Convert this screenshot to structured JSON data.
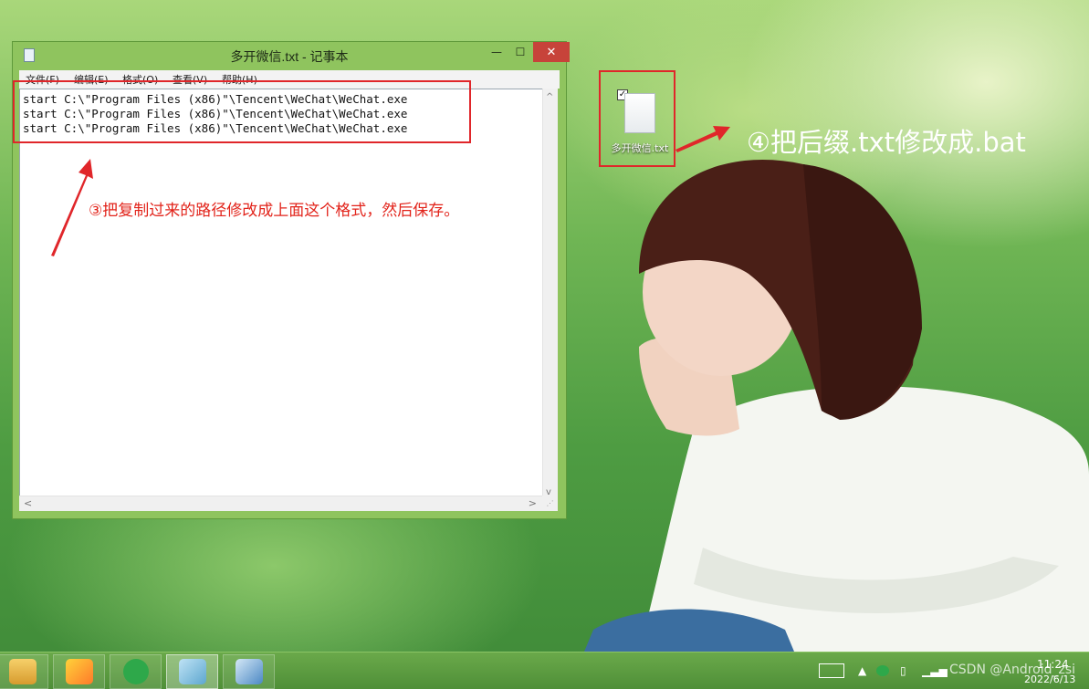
{
  "notepad": {
    "title": "多开微信.txt - 记事本",
    "controls": {
      "minimize": "—",
      "maximize": "☐",
      "close": "✕"
    },
    "menu": [
      "文件(F)",
      "编辑(E)",
      "格式(O)",
      "查看(V)",
      "帮助(H)"
    ],
    "lines": [
      "start C:\\\"Program Files (x86)\"\\Tencent\\WeChat\\WeChat.exe",
      "start C:\\\"Program Files (x86)\"\\Tencent\\WeChat\\WeChat.exe",
      "start C:\\\"Program Files (x86)\"\\Tencent\\WeChat\\WeChat.exe"
    ]
  },
  "annotations": {
    "step3": "③把复制过来的路径修改成上面这个格式，然后保存。",
    "step4": "④把后缀.txt修改成.bat",
    "color": "#e0262a"
  },
  "desktop_icon": {
    "label": "多开微信.txt",
    "checked": true,
    "icon": "text-file-icon"
  },
  "taskbar": {
    "apps": [
      "file-explorer-icon",
      "qq-tencent-icon",
      "wechat-icon",
      "notepad-icon",
      "control-panel-icon"
    ],
    "tray_items": [
      "keyboard-icon",
      "show-hidden-icons-chevron",
      "wechat-tray-icon",
      "network-icon",
      "signal-icon",
      "volume-icon"
    ],
    "clock_time": "11:24",
    "clock_date": "2022/6/13"
  },
  "watermark": "CSDN @Android_zsi"
}
